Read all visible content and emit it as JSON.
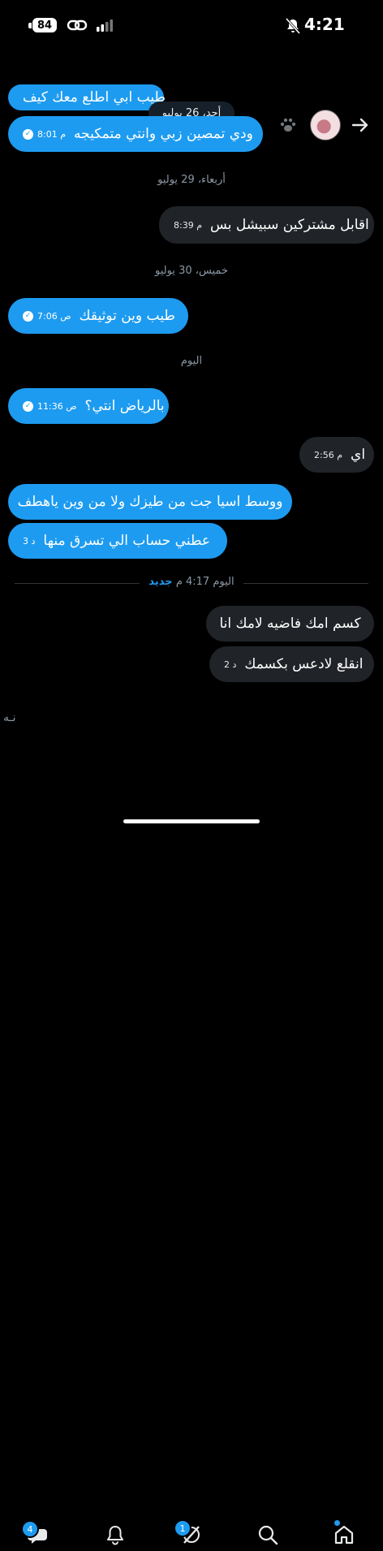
{
  "status_bar": {
    "battery": "84",
    "time": "4:21"
  },
  "header": {
    "avatar_desc": "lips-avatar"
  },
  "date_pill": "أحد، 26 يوليو",
  "separators": {
    "wed": "أربعاء، 29 يوليو",
    "thu": "خميس، 30 يوليو",
    "today": "اليوم"
  },
  "messages": [
    {
      "text": "طيب ابي اطلع معك كيف",
      "time": "",
      "dir": "in"
    },
    {
      "text": "ودي تمصين زبي وانتي متمكيجه",
      "time": "8:01 م",
      "dir": "in"
    },
    {
      "text": "اقابل مشتركين سبيشل بس",
      "time": "8:39 م",
      "dir": "out"
    },
    {
      "text": "طيب وين توثيقك",
      "time": "7:06 ص",
      "dir": "in"
    },
    {
      "text": "بالرياض انتي؟",
      "time": "11:36 ص",
      "dir": "in"
    },
    {
      "text": "اي",
      "time": "2:56 م",
      "dir": "out"
    },
    {
      "text": "ووسط اسيا جت من طيزك ولا من وين ياهطف",
      "time": "",
      "dir": "in"
    },
    {
      "text": "عطني حساب الي تسرق منها",
      "time": "3 د",
      "dir": "in"
    },
    {
      "text": "كسم امك فاضيه لامك انا",
      "time": "",
      "dir": "out"
    },
    {
      "text": "انقلع لادعس بكسمك",
      "time": "2 د",
      "dir": "out"
    }
  ],
  "new_divider": {
    "time": "اليوم 4:17 م",
    "label": "جديد"
  },
  "typing_text": "نـه",
  "bottom_nav": {
    "messages_badge": "4",
    "grok_badge": "1"
  },
  "colors": {
    "accent": "#1d9bf0",
    "outgoing_bubble": "#202327",
    "background": "#000000"
  }
}
